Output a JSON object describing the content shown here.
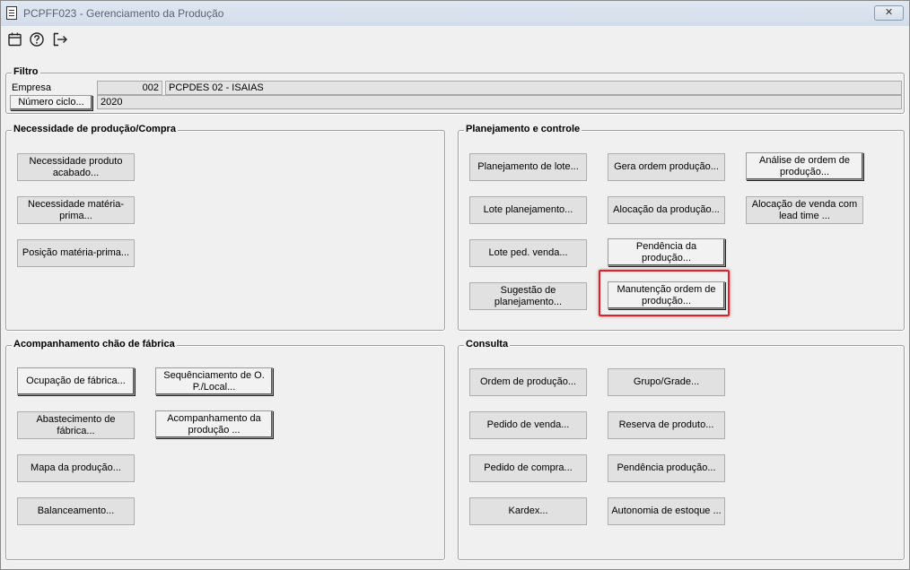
{
  "window": {
    "title": "PCPFF023 - Gerenciamento da Produção",
    "close_glyph": "✕"
  },
  "toolbar": {
    "icons": [
      "calendar-icon",
      "help-icon",
      "exit-icon"
    ]
  },
  "filter": {
    "legend": "Filtro",
    "empresa_label": "Empresa",
    "empresa_code": "002",
    "empresa_name": "PCPDES 02 - ISAIAS",
    "ciclo_button": "Número ciclo...",
    "ciclo_value": "2020"
  },
  "necessidade": {
    "legend": "Necessidade de produção/Compra",
    "buttons": [
      "Necessidade produto acabado...",
      "Necessidade matéria-prima...",
      "Posição matéria-prima..."
    ]
  },
  "planejamento": {
    "legend": "Planejamento e controle",
    "buttons": [
      "Planejamento de lote...",
      "Gera ordem produção...",
      "Análise de ordem de produção...",
      "Lote planejamento...",
      "Alocação da produção...",
      "Alocação de venda com lead time ...",
      "Lote ped. venda...",
      "Pendência da produção...",
      "Sugestão de planejamento...",
      "Manutenção ordem de produção..."
    ]
  },
  "acompanhamento": {
    "legend": "Acompanhamento chão de fábrica",
    "buttons": [
      "Ocupação de fábrica...",
      "Sequênciamento de O. P./Local...",
      "Abastecimento de fábrica...",
      "Acompanhamento da produção ...",
      "Mapa da produção...",
      "Balanceamento..."
    ]
  },
  "consulta": {
    "legend": "Consulta",
    "buttons": [
      "Ordem de produção...",
      "Grupo/Grade...",
      "Pedido de venda...",
      "Reserva de produto...",
      "Pedido de compra...",
      "Pendência produção...",
      "Kardex...",
      "Autonomia de estoque ..."
    ]
  }
}
